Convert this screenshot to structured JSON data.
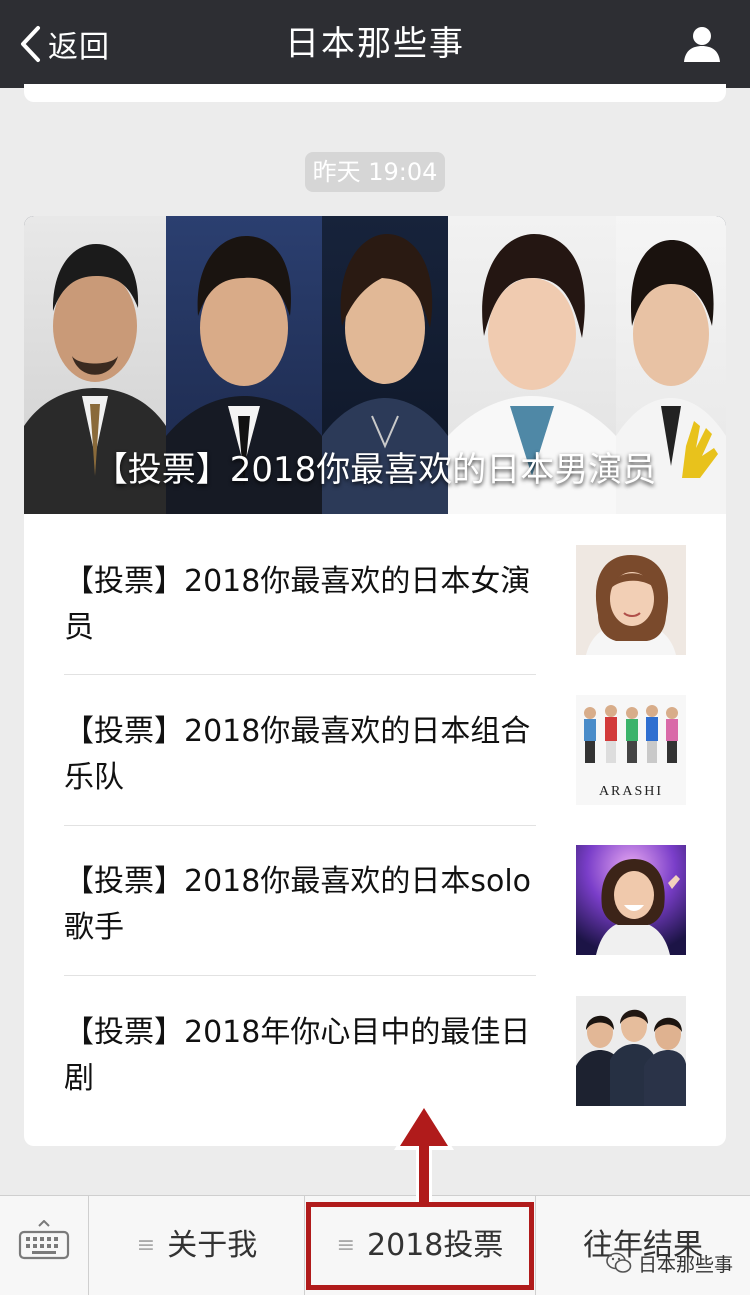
{
  "header": {
    "back_label": "返回",
    "title": "日本那些事"
  },
  "chat": {
    "timestamp": "昨天 19:04",
    "cover": {
      "title": "【投票】2018你最喜欢的日本男演员"
    },
    "items": [
      {
        "title": "【投票】2018你最喜欢的日本女演员",
        "thumb": "actress-photo"
      },
      {
        "title": "【投票】2018你最喜欢的日本组合乐队",
        "thumb": "arashi-group-photo",
        "thumb_text": "ARASHI"
      },
      {
        "title": "【投票】2018你最喜欢的日本solo歌手",
        "thumb": "concert-singer-photo"
      },
      {
        "title": "【投票】2018年你心目中的最佳日剧",
        "thumb": "drama-cast-photo"
      }
    ]
  },
  "menu": {
    "items": [
      {
        "label": "关于我"
      },
      {
        "label": "2018投票"
      },
      {
        "label": "往年结果"
      }
    ]
  },
  "watermark": "日本那些事",
  "colors": {
    "titlebar": "#2d2e33",
    "highlight": "#b01b1b",
    "background": "#ececec"
  },
  "icons": [
    "back-chevron-icon",
    "profile-icon",
    "keyboard-icon",
    "menu-hamburger-icon",
    "wechat-icon"
  ]
}
